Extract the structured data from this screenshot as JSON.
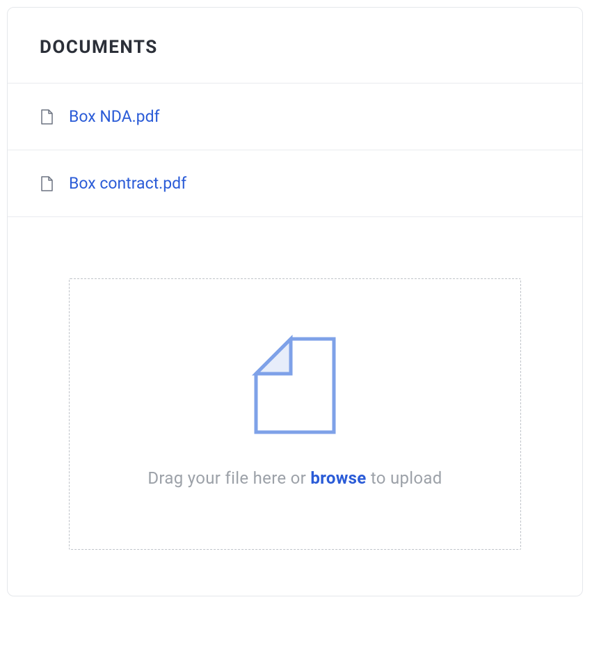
{
  "panel": {
    "title": "DOCUMENTS"
  },
  "documents": [
    {
      "name": "Box NDA.pdf"
    },
    {
      "name": "Box contract.pdf"
    }
  ],
  "upload": {
    "prompt_prefix": "Drag your file here or ",
    "browse_label": "browse",
    "prompt_suffix": " to upload"
  },
  "colors": {
    "link": "#2a5bd7",
    "muted": "#9ca1a8",
    "border": "#e5e7eb"
  }
}
